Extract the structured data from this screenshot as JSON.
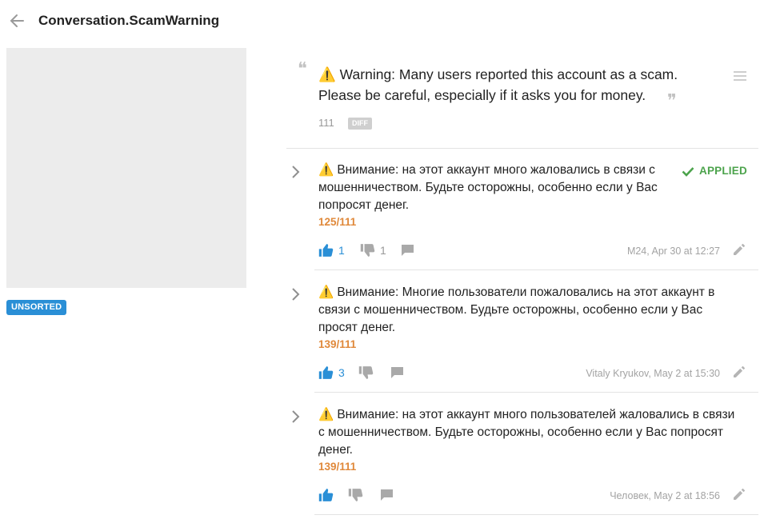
{
  "header": {
    "title": "Conversation.ScamWarning"
  },
  "sidebar": {
    "badge": "UNSORTED"
  },
  "source": {
    "warning_glyph": "⚠️",
    "text": "Warning: Many users reported this account as a scam. Please be careful, especially if it asks you for money.",
    "length": "111",
    "diff_label": "DIFF",
    "quote_open": "❝",
    "quote_close": "❞"
  },
  "suggestions": [
    {
      "warning_glyph": "⚠️",
      "text": "Внимание: на этот аккаунт много жаловались в связи с мошенничеством. Будьте осторожны, особенно если у Вас попросят денег.",
      "length": "125/111",
      "status": "APPLIED",
      "upvotes": "1",
      "downvotes": "1",
      "meta": "M24, Apr 30 at 12:27"
    },
    {
      "warning_glyph": "⚠️",
      "text": "Внимание: Многие пользователи пожаловались на этот аккаунт в связи с мошенничеством. Будьте осторожны, особенно если у Вас просят денег.",
      "length": "139/111",
      "upvotes": "3",
      "meta": "Vitaly Kryukov, May 2 at 15:30"
    },
    {
      "warning_glyph": "⚠️",
      "text": "Внимание: на этот аккаунт много пользователей жаловались в связи с мошенничеством. Будьте осторожны, особенно если у Вас попросят денег.",
      "length": "139/111",
      "meta": "Человек, May 2 at 18:56"
    }
  ],
  "colors": {
    "accent": "#2a8fd6",
    "applied": "#4ca34c",
    "length": "#e0893b",
    "muted": "#a3a3a3"
  },
  "icons": [
    "back-arrow-icon",
    "menu-icon",
    "chevron-right-icon",
    "thumbs-up-icon",
    "thumbs-down-icon",
    "comment-icon",
    "pencil-icon",
    "check-icon",
    "warning-icon"
  ]
}
